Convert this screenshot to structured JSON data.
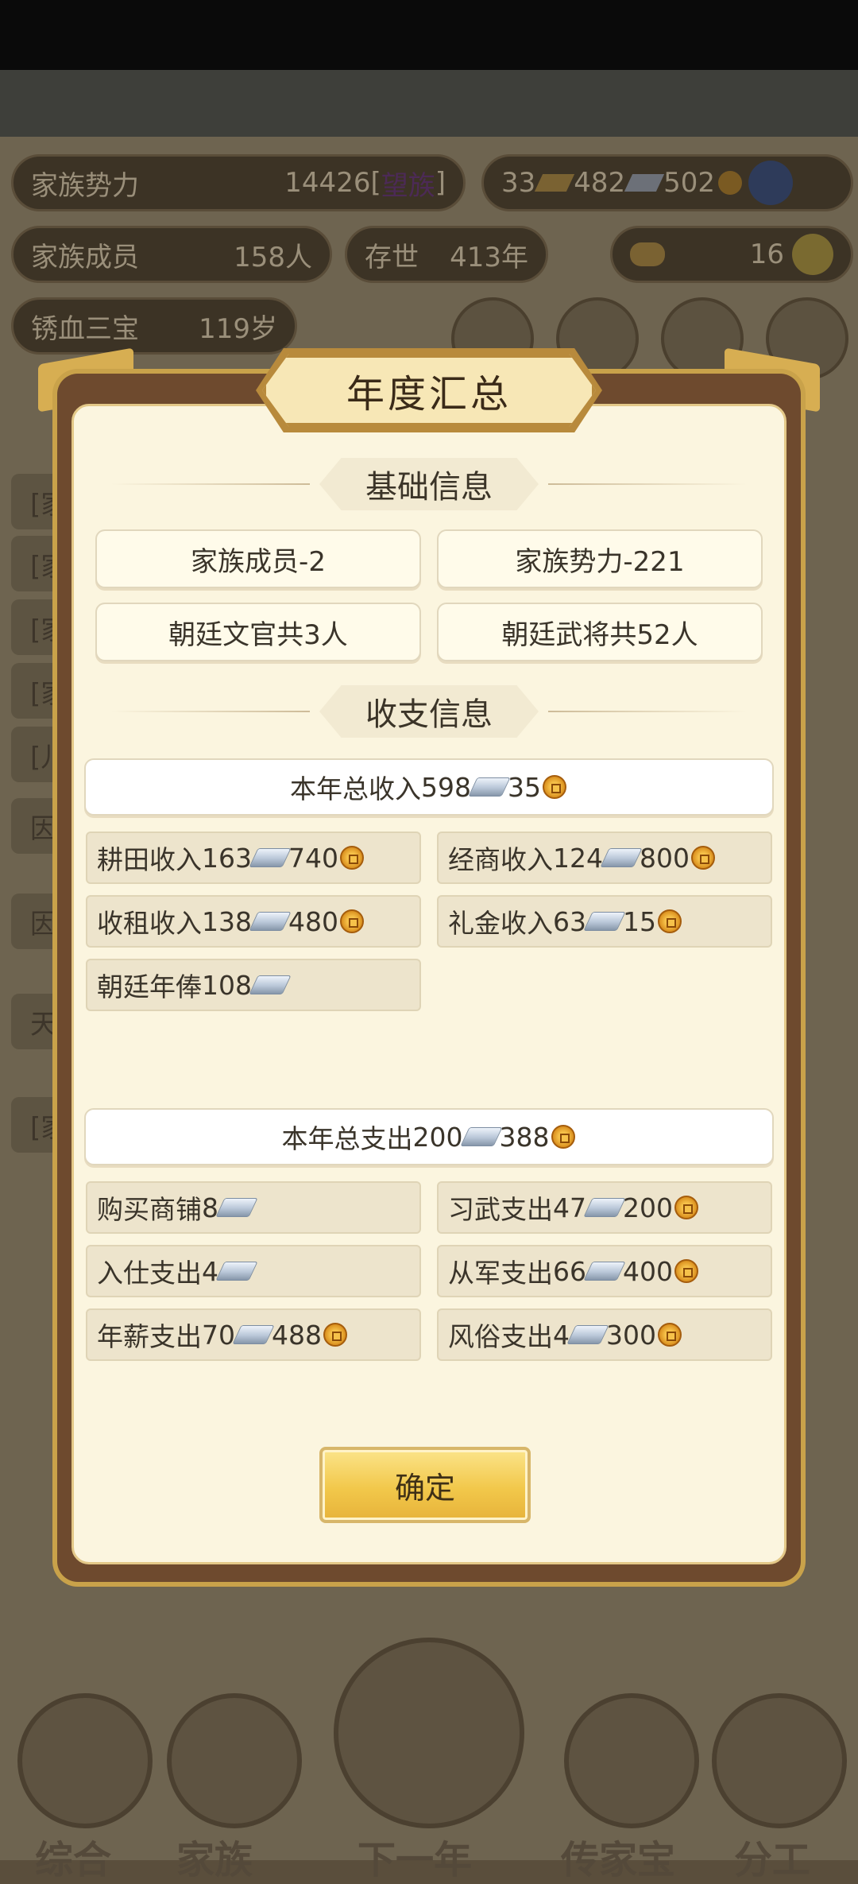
{
  "bg": {
    "family_power_label": "家族势力",
    "family_power_value": "14426",
    "family_power_bracket_open": "[",
    "family_power_rank": "望族",
    "family_power_bracket_close": "]",
    "gold": "33",
    "silver": "482",
    "copper": "502",
    "members_label": "家族成员",
    "members_value": "158人",
    "exist_label": "存世",
    "exist_value": "413年",
    "ingot_count": "16",
    "treasure_label": "锈血三宝",
    "treasure_age": "119岁",
    "log_lines": [
      "[家",
      "[家",
      "[家",
      "[家",
      "[儿",
      "因",
      "因",
      "天",
      "[家"
    ],
    "nav": [
      "综合",
      "家族",
      "下一年",
      "传家宝",
      "分工"
    ]
  },
  "modal": {
    "title": "年度汇总",
    "basic_title": "基础信息",
    "basic": [
      "家族成员-2",
      "家族势力-221",
      "朝廷文官共3人",
      "朝廷武将共52人"
    ],
    "finance_title": "收支信息",
    "income_total": {
      "label": "本年总收入 ",
      "silver": "598",
      "copper": "35"
    },
    "income_items": [
      {
        "label": "耕田收入",
        "silver": "163",
        "copper": "740"
      },
      {
        "label": "经商收入",
        "silver": "124",
        "copper": "800"
      },
      {
        "label": "收租收入",
        "silver": "138",
        "copper": "480"
      },
      {
        "label": "礼金收入",
        "silver": "63",
        "copper": "15"
      },
      {
        "label": "朝廷年俸",
        "silver": "108",
        "copper": ""
      }
    ],
    "expense_total": {
      "label": "本年总支出",
      "silver": "200",
      "copper": "388"
    },
    "expense_items": [
      {
        "label": "购买商铺",
        "silver": "8",
        "copper": ""
      },
      {
        "label": "习武支出",
        "silver": "47",
        "copper": "200"
      },
      {
        "label": "入仕支出",
        "silver": "4",
        "copper": ""
      },
      {
        "label": "从军支出",
        "silver": "66",
        "copper": "400"
      },
      {
        "label": "年薪支出",
        "silver": "70",
        "copper": "488"
      },
      {
        "label": "风俗支出",
        "silver": "4",
        "copper": "300"
      }
    ],
    "confirm": "确定"
  }
}
